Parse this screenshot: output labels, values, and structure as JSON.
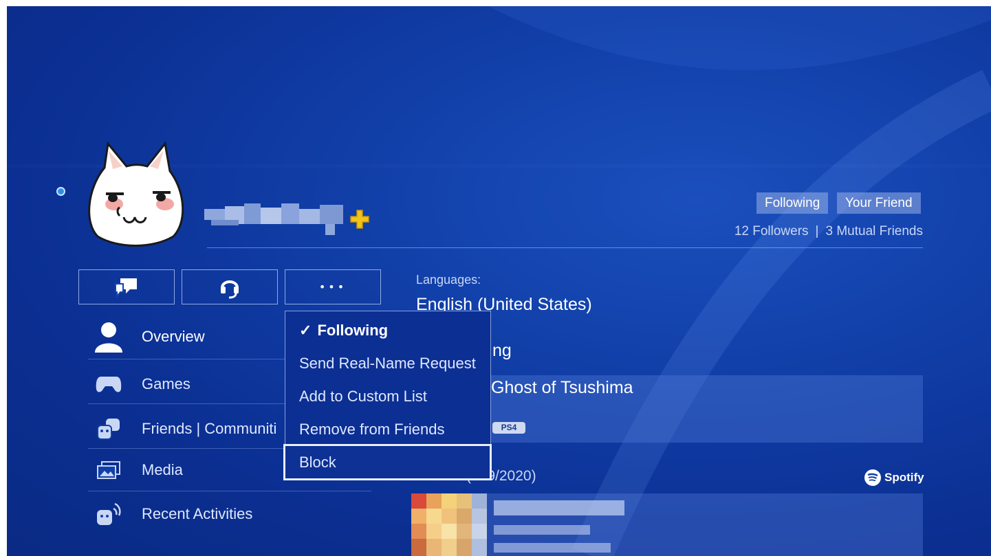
{
  "profile": {
    "online": true,
    "has_plus": true,
    "badges": [
      "Following",
      "Your Friend"
    ],
    "followers": "12 Followers",
    "mutual_friends": "3 Mutual Friends",
    "separator": "|"
  },
  "actions": {
    "message_icon": "message-bubbles-icon",
    "party_icon": "headset-icon",
    "more_icon": "ellipsis-icon",
    "more_label": "•••"
  },
  "nav": {
    "items": [
      {
        "label": "Overview",
        "icon": "person-icon",
        "active": true
      },
      {
        "label": "Games",
        "icon": "gamepad-icon"
      },
      {
        "label": "Friends | Communiti",
        "icon": "friends-icon"
      },
      {
        "label": "Media",
        "icon": "media-icon"
      },
      {
        "label": "Recent Activities",
        "icon": "activity-icon"
      }
    ]
  },
  "details": {
    "languages_label": "Languages:",
    "languages_value": "English (United States)",
    "now_playing_suffix": "ng",
    "game_title": "Ghost of Tsushima",
    "game_platform": "PS4",
    "music_label": "(1. 9/2020)",
    "music_service": "Spotify"
  },
  "menu": {
    "items": [
      {
        "label": "Following",
        "checked": true,
        "check": "✓"
      },
      {
        "label": "Send Real-Name Request"
      },
      {
        "label": "Add to Custom List"
      },
      {
        "label": "Remove from Friends"
      },
      {
        "label": "Block",
        "focused": true
      }
    ]
  },
  "colors": {
    "background": "#113fa8",
    "accent": "#2f8fe8",
    "plus": "#f2c318"
  }
}
